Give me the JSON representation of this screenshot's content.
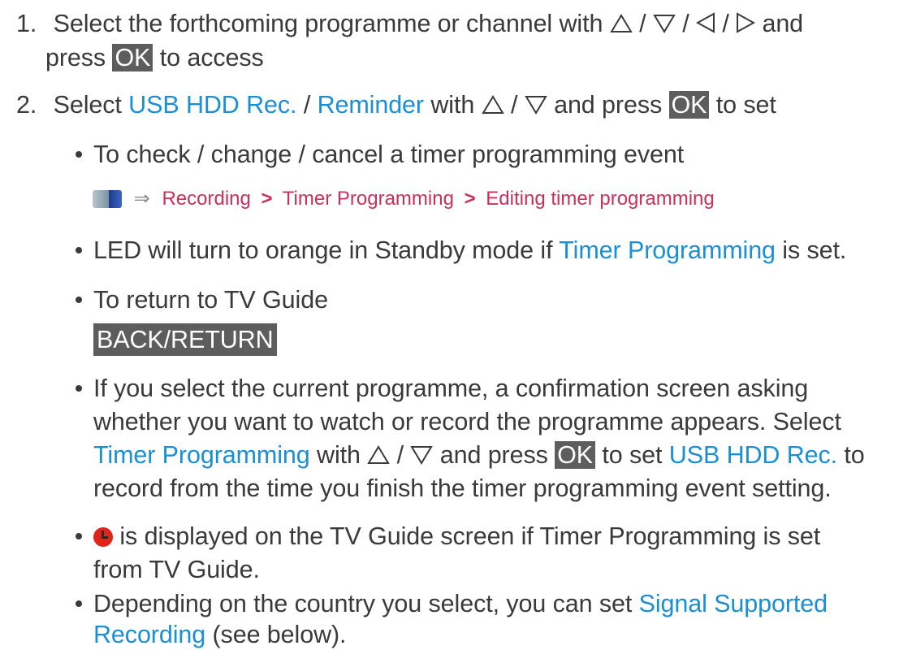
{
  "step1": {
    "number": "1.",
    "text_a": "Select the forthcoming programme or channel with",
    "sep1": "/",
    "sep2": "/",
    "sep3": "/",
    "text_b": "and",
    "text_c": "press",
    "ok_key": "OK",
    "text_d": "to access"
  },
  "step2": {
    "number": "2.",
    "text_a": "Select",
    "link1": "USB HDD Rec.",
    "sep": "/",
    "link2": "Reminder",
    "text_b": "with",
    "sep_arrows": "/",
    "text_c": "and press",
    "ok_key": "OK",
    "text_d": "to set"
  },
  "bullets": {
    "b1_text": "To check / change / cancel a timer programming event",
    "path": {
      "item1": "Recording",
      "sep1": ">",
      "item2": "Timer Programming",
      "sep2": ">",
      "item3": "Editing timer programming",
      "arrow": "⇒"
    },
    "b2_text_a": "LED will turn to orange in Standby mode if",
    "b2_link": "Timer Programming",
    "b2_text_b": "is set.",
    "b3_text": "To return to TV Guide",
    "back_key": "BACK/RETURN",
    "b4_line1": "If you select the current programme, a confirmation screen asking",
    "b4_line2": "whether you want to watch or record the programme appears. Select",
    "b4_line3_link1": "Timer Programming",
    "b4_line3_text_a": "with",
    "b4_line3_sep": "/",
    "b4_line3_text_b": "and press",
    "b4_line3_ok": "OK",
    "b4_line3_text_c": "to set",
    "b4_line3_link2": "USB HDD Rec.",
    "b4_line3_text_d": "to",
    "b4_line4": "record from the time you finish the timer programming event setting.",
    "b5_line1": "is displayed on the TV Guide screen if Timer Programming is set",
    "b5_line2": "from TV Guide.",
    "b6_line1_text": "Depending on the country you select, you can set",
    "b6_line1_link": "Signal Supported",
    "b6_line2_link": "Recording",
    "b6_line2_text": "(see below)."
  },
  "icons": {
    "up": "up-triangle-icon",
    "down": "down-triangle-icon",
    "left": "left-triangle-icon",
    "right": "right-triangle-icon",
    "menu": "menu-icon",
    "timer": "timer-clock-icon"
  },
  "colors": {
    "text": "#3a3a3a",
    "link": "#1a8fd6",
    "path": "#c8325a",
    "key_bg": "#5d5d5d",
    "timer_icon": "#e2231a"
  }
}
